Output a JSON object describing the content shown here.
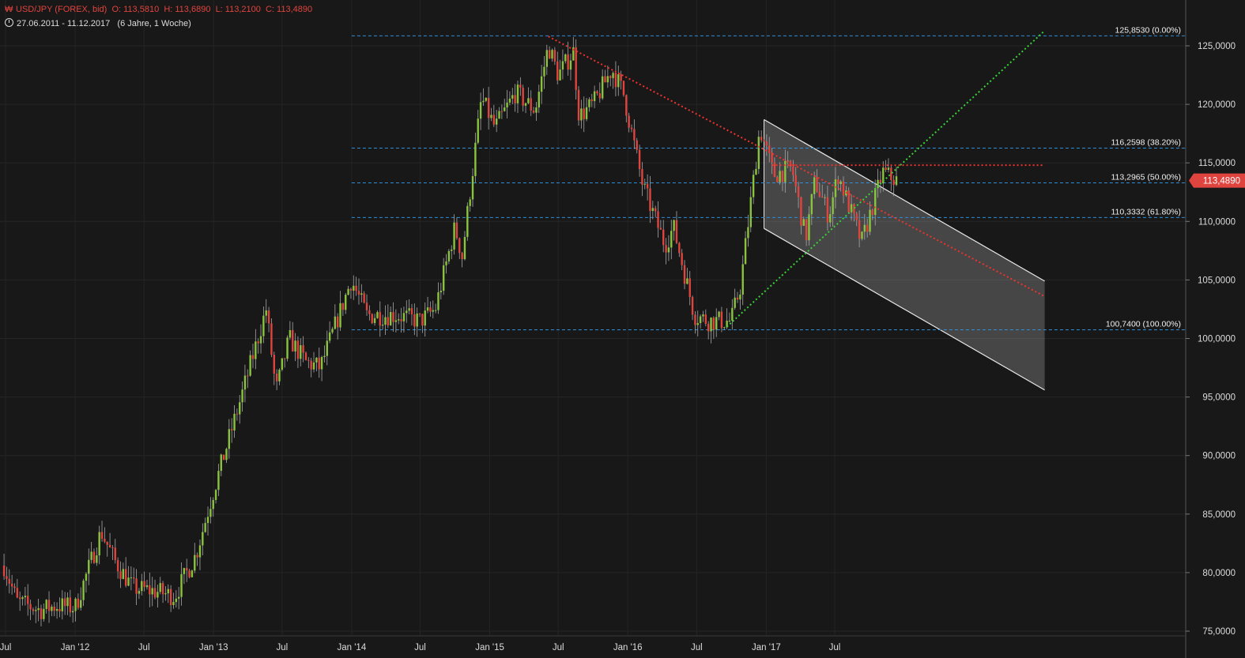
{
  "header": {
    "instrument": "USD/JPY (FOREX, bid)",
    "open": "O: 113,5810",
    "high": "H: 113,6890",
    "low": "L: 113,2100",
    "close": "C: 113,4890",
    "range": "27.06.2011 - 11.12.2017",
    "period": "(6 Jahre, 1 Woche)"
  },
  "colors": {
    "background": "#181818",
    "up": "#8ac43f",
    "down": "#e0443e",
    "fib": "#2f8fd8",
    "channel": "#e8e8e8",
    "text": "#dcdcdc",
    "price_tag": "#e0443e"
  },
  "chart_data": {
    "type": "candlestick",
    "x_range": [
      "2011-06-27",
      "2017-12-11"
    ],
    "ylim": [
      74.5,
      127
    ],
    "y_ticks": [
      "75,0000",
      "80,0000",
      "85,0000",
      "90,0000",
      "95,0000",
      "100,0000",
      "105,0000",
      "110,0000",
      "115,0000",
      "120,0000",
      "125,0000"
    ],
    "y_tick_values": [
      75,
      80,
      85,
      90,
      95,
      100,
      105,
      110,
      115,
      120,
      125
    ],
    "x_ticks": [
      {
        "label": "Jul",
        "date": "2011-07-01"
      },
      {
        "label": "Jan '12",
        "date": "2012-01-01"
      },
      {
        "label": "Jul",
        "date": "2012-07-01"
      },
      {
        "label": "Jan '13",
        "date": "2013-01-01"
      },
      {
        "label": "Jul",
        "date": "2013-07-01"
      },
      {
        "label": "Jan '14",
        "date": "2014-01-01"
      },
      {
        "label": "Jul",
        "date": "2014-07-01"
      },
      {
        "label": "Jan '15",
        "date": "2015-01-01"
      },
      {
        "label": "Jul",
        "date": "2015-07-01"
      },
      {
        "label": "Jan '16",
        "date": "2016-01-01"
      },
      {
        "label": "Jul",
        "date": "2016-07-01"
      },
      {
        "label": "Jan '17",
        "date": "2017-01-01"
      },
      {
        "label": "Jul",
        "date": "2017-07-01"
      }
    ],
    "price_path": [
      {
        "date": "2011-06-27",
        "close": 80.6
      },
      {
        "date": "2011-08-01",
        "close": 77.5
      },
      {
        "date": "2011-10-01",
        "close": 76.8
      },
      {
        "date": "2011-11-15",
        "close": 77.2
      },
      {
        "date": "2012-01-01",
        "close": 77.0
      },
      {
        "date": "2012-03-10",
        "close": 83.5
      },
      {
        "date": "2012-04-15",
        "close": 81.0
      },
      {
        "date": "2012-06-01",
        "close": 78.7
      },
      {
        "date": "2012-08-01",
        "close": 78.4
      },
      {
        "date": "2012-09-20",
        "close": 78.0
      },
      {
        "date": "2012-11-15",
        "close": 81.5
      },
      {
        "date": "2013-01-01",
        "close": 87.0
      },
      {
        "date": "2013-03-15",
        "close": 95.0
      },
      {
        "date": "2013-05-20",
        "close": 102.5
      },
      {
        "date": "2013-06-15",
        "close": 95.5
      },
      {
        "date": "2013-07-20",
        "close": 100.0
      },
      {
        "date": "2013-09-01",
        "close": 98.0
      },
      {
        "date": "2013-10-10",
        "close": 97.5
      },
      {
        "date": "2013-12-31",
        "close": 105.0
      },
      {
        "date": "2014-02-10",
        "close": 102.0
      },
      {
        "date": "2014-05-01",
        "close": 102.0
      },
      {
        "date": "2014-07-01",
        "close": 101.5
      },
      {
        "date": "2014-08-10",
        "close": 102.5
      },
      {
        "date": "2014-10-01",
        "close": 109.5
      },
      {
        "date": "2014-10-20",
        "close": 107.0
      },
      {
        "date": "2014-12-10",
        "close": 120.5
      },
      {
        "date": "2015-01-15",
        "close": 118.0
      },
      {
        "date": "2015-03-10",
        "close": 121.0
      },
      {
        "date": "2015-05-01",
        "close": 119.5
      },
      {
        "date": "2015-06-05",
        "close": 125.0
      },
      {
        "date": "2015-07-01",
        "close": 122.5
      },
      {
        "date": "2015-08-10",
        "close": 124.5
      },
      {
        "date": "2015-08-25",
        "close": 119.0
      },
      {
        "date": "2015-10-01",
        "close": 120.0
      },
      {
        "date": "2015-11-20",
        "close": 123.0
      },
      {
        "date": "2015-12-20",
        "close": 121.0
      },
      {
        "date": "2016-02-10",
        "close": 113.0
      },
      {
        "date": "2016-04-08",
        "close": 108.0
      },
      {
        "date": "2016-05-01",
        "close": 109.5
      },
      {
        "date": "2016-06-25",
        "close": 102.0
      },
      {
        "date": "2016-08-01",
        "close": 101.5
      },
      {
        "date": "2016-09-30",
        "close": 101.5
      },
      {
        "date": "2016-10-25",
        "close": 104.5
      },
      {
        "date": "2016-12-15",
        "close": 118.0
      },
      {
        "date": "2017-01-20",
        "close": 114.0
      },
      {
        "date": "2017-03-10",
        "close": 114.5
      },
      {
        "date": "2017-04-15",
        "close": 108.5
      },
      {
        "date": "2017-05-10",
        "close": 113.5
      },
      {
        "date": "2017-06-15",
        "close": 110.5
      },
      {
        "date": "2017-07-10",
        "close": 114.0
      },
      {
        "date": "2017-09-10",
        "close": 108.2
      },
      {
        "date": "2017-11-05",
        "close": 114.2
      },
      {
        "date": "2017-12-11",
        "close": 113.489
      }
    ],
    "fibonacci_levels": [
      {
        "label": "125,8530 (0.00%)",
        "value": 125.853
      },
      {
        "label": "116,2598 (38.20%)",
        "value": 116.2598
      },
      {
        "label": "113,2965 (50.00%)",
        "value": 113.2965
      },
      {
        "label": "110,3332 (61.80%)",
        "value": 110.3332
      },
      {
        "label": "100,7400 (100.00%)",
        "value": 100.74
      }
    ],
    "fib_start_date": "2014-01-01",
    "trendlines": [
      {
        "name": "downtrend",
        "color": "red",
        "style": "dotted",
        "from": {
          "date": "2015-06-05",
          "value": 125.8
        },
        "to": {
          "date": "2019-01-07",
          "value": 103.6
        }
      },
      {
        "name": "uptrend",
        "color": "green",
        "style": "dotted",
        "from": {
          "date": "2016-09-19",
          "value": 101.0
        },
        "to": {
          "date": "2019-01-07",
          "value": 126.3
        }
      },
      {
        "name": "horizontal",
        "color": "red",
        "style": "dotted",
        "from": {
          "date": "2017-01-16",
          "value": 114.8
        },
        "to": {
          "date": "2019-01-07",
          "value": 114.8
        }
      }
    ],
    "channel": {
      "upper": {
        "from": {
          "date": "2016-12-26",
          "value": 118.7
        },
        "to": {
          "date": "2019-01-07",
          "value": 104.9
        }
      },
      "lower": {
        "from": {
          "date": "2016-12-26",
          "value": 109.4
        },
        "to": {
          "date": "2019-01-07",
          "value": 95.6
        }
      }
    },
    "current_price": {
      "label": "113,4890",
      "value": 113.489
    }
  }
}
